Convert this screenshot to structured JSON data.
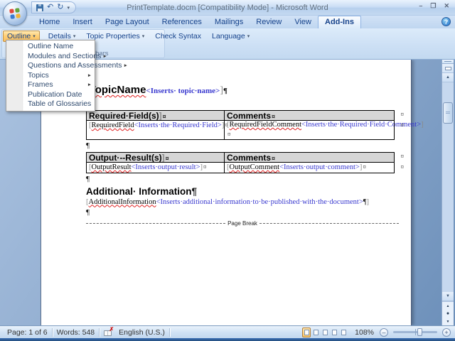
{
  "window": {
    "title": "PrintTemplate.docm [Compatibility Mode] - Microsoft Word"
  },
  "icons": {
    "minimize": "–",
    "restore": "❐",
    "close": "✕",
    "dropdown_arrow": "▾",
    "submenu_arrow": "►",
    "undo": "↶",
    "redo": "↻",
    "qat_more": "▾",
    "help": "?",
    "scroll_up": "▲",
    "scroll_down": "▼",
    "prev_object": "▲",
    "browse_object": "●",
    "next_object": "▼",
    "spell_x": "✗",
    "zoom_out": "–",
    "zoom_in": "+"
  },
  "tabs": [
    {
      "label": "Home"
    },
    {
      "label": "Insert"
    },
    {
      "label": "Page Layout"
    },
    {
      "label": "References"
    },
    {
      "label": "Mailings"
    },
    {
      "label": "Review"
    },
    {
      "label": "View"
    },
    {
      "label": "Add-Ins",
      "active": true
    }
  ],
  "ribbon": {
    "group_label": "Custom Toolbars",
    "buttons": [
      {
        "label": "Outline",
        "dropdown": true,
        "pressed": true
      },
      {
        "label": "Details",
        "dropdown": true
      },
      {
        "label": "Topic Properties",
        "dropdown": true
      },
      {
        "label": "Check Syntax",
        "dropdown": false
      },
      {
        "label": "Language",
        "dropdown": true
      }
    ]
  },
  "menu": {
    "items": [
      {
        "label": "Outline Name",
        "submenu": false
      },
      {
        "label": "Modules and Sections",
        "submenu": true
      },
      {
        "label": "Questions and Assessments",
        "submenu": true
      },
      {
        "label": "Topics",
        "submenu": true
      },
      {
        "label": "Frames",
        "submenu": true
      },
      {
        "label": "Publication Date",
        "submenu": false
      },
      {
        "label": "Table of Glossaries",
        "submenu": false
      }
    ]
  },
  "doc": {
    "marks": {
      "open": "[",
      "close": "]",
      "cell_end": "¤",
      "pilcrow": "¶"
    },
    "topic": {
      "name": "TopicName",
      "insert": "<Inserts· topic·name>"
    },
    "table1": {
      "h1": "Required·Field(s)",
      "h2": "Comments",
      "c1_name": "RequiredField",
      "c1_insert": "<Inserts·the·Required·Field>",
      "c2_name": "RequiredFieldComment",
      "c2_insert": "<Inserts·the·Required·Field·Comment>"
    },
    "table2": {
      "h1": "Output·--Result(s)",
      "h2": "Comments",
      "c1_name": "OutputResult",
      "c1_insert": "<Inserts·output·result>",
      "c2_name": "OutputComment",
      "c2_insert": "<Inserts·output·comment>"
    },
    "additional": {
      "heading": "Additional· Information",
      "name": "AdditionalInformation",
      "insert": "<Inserts·additional·information·to·be·published·with·the·document>"
    },
    "page_break_label": "Page Break"
  },
  "statusbar": {
    "page": "Page: 1 of 6",
    "words": "Words: 548",
    "language": "English (U.S.)",
    "zoom": "108%"
  },
  "colors": {
    "pressed_button_orange": "#fbbf5e",
    "insert_text_blue": "#3838cf",
    "spellcheck_red": "#e02020",
    "title_bar_blue": "#c3d8f0",
    "document_background": "#8fabcf"
  }
}
